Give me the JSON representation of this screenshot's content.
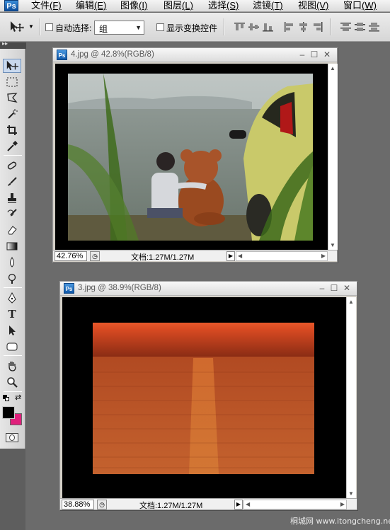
{
  "app": {
    "logo": "Ps"
  },
  "menu": [
    {
      "text": "文件",
      "key": "(F)"
    },
    {
      "text": "编辑",
      "key": "(E)"
    },
    {
      "text": "图像",
      "key": "(I)"
    },
    {
      "text": "图层",
      "key": "(L)"
    },
    {
      "text": "选择",
      "key": "(S)"
    },
    {
      "text": "滤镜",
      "key": "(T)"
    },
    {
      "text": "视图",
      "key": "(V)"
    },
    {
      "text": "窗口",
      "key": "(W)"
    }
  ],
  "options": {
    "auto_select_label": "自动选择:",
    "auto_select_value": "组",
    "show_transform_label": "显示变换控件"
  },
  "tools": [
    "move-tool",
    "marquee-tool",
    "lasso-tool",
    "magic-wand-tool",
    "crop-tool",
    "eyedropper-tool",
    "healing-brush-tool",
    "brush-tool",
    "clone-stamp-tool",
    "history-brush-tool",
    "eraser-tool",
    "gradient-tool",
    "blur-tool",
    "dodge-tool",
    "pen-tool",
    "type-tool",
    "path-selection-tool",
    "shape-tool",
    "hand-tool",
    "zoom-tool"
  ],
  "colors": {
    "foreground": "#000000",
    "background": "#e0207c",
    "accent": "#1058a8"
  },
  "documents": [
    {
      "title": "4.jpg @ 42.8%(RGB/8)",
      "zoom": "42.76%",
      "doc_info": "文档:1.27M/1.27M",
      "image": "couple-with-teddy-bear-at-seaside"
    },
    {
      "title": "3.jpg @ 38.9%(RGB/8)",
      "zoom": "38.88%",
      "doc_info": "文档:1.27M/1.27M",
      "image": "sunset-over-sea"
    }
  ],
  "watermark": "桐城网 www.itongcheng.net"
}
